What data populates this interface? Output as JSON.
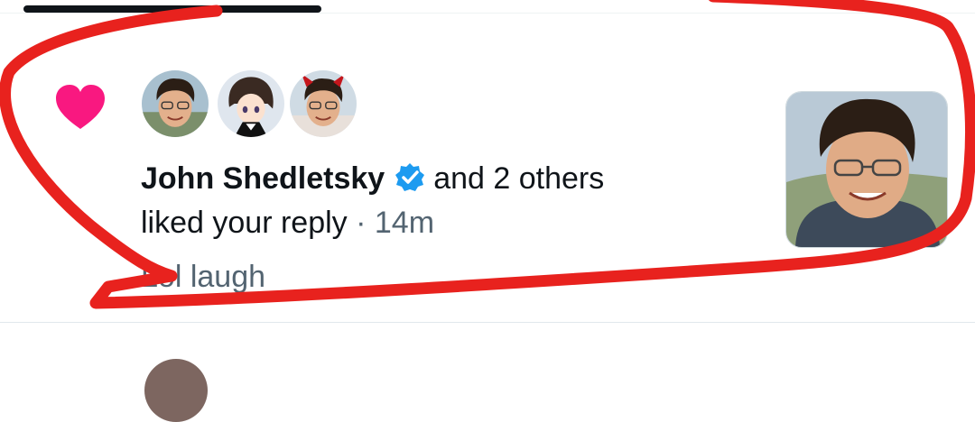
{
  "notification": {
    "type": "like",
    "user_name": "John Shedletsky",
    "verified": true,
    "others_text": "and 2 others",
    "action_text": "liked your reply",
    "separator": "·",
    "time": "14m",
    "reply_text": "Lol laugh",
    "avatars": [
      "john-shedletsky-avatar",
      "anime-avatar",
      "devil-horns-avatar"
    ]
  },
  "colors": {
    "heart": "#f91880",
    "verified": "#1d9bf0",
    "annotation": "#e8221e",
    "secondary_text": "#536471"
  }
}
